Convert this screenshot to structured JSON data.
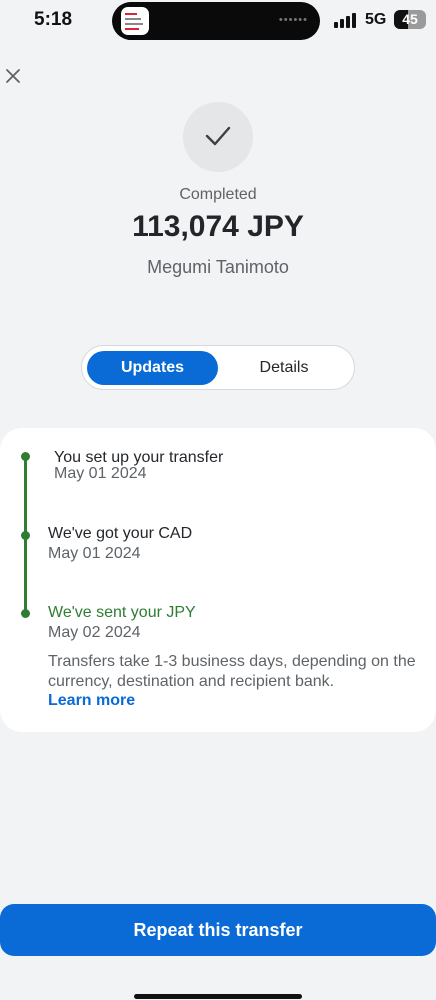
{
  "status_bar": {
    "time": "5:18",
    "network": "5G",
    "battery": "45",
    "battery_level": 0.45
  },
  "transfer": {
    "status": "Completed",
    "amount": "113,074 JPY",
    "recipient": "Megumi Tanimoto"
  },
  "tabs": [
    {
      "label": "Updates",
      "active": true
    },
    {
      "label": "Details",
      "active": false
    }
  ],
  "timeline": [
    {
      "title": "You set up your transfer",
      "date": "May 01 2024"
    },
    {
      "title": "We've got your CAD",
      "date": "May 01 2024"
    },
    {
      "title": "We've sent your JPY",
      "date": "May 02 2024"
    }
  ],
  "note": "Transfers take 1-3 business days, depending on the currency, destination and recipient bank.",
  "learn_more": "Learn more",
  "repeat_button": "Repeat this transfer",
  "colors": {
    "accent": "#0a6bd6",
    "success": "#2e7d32"
  }
}
